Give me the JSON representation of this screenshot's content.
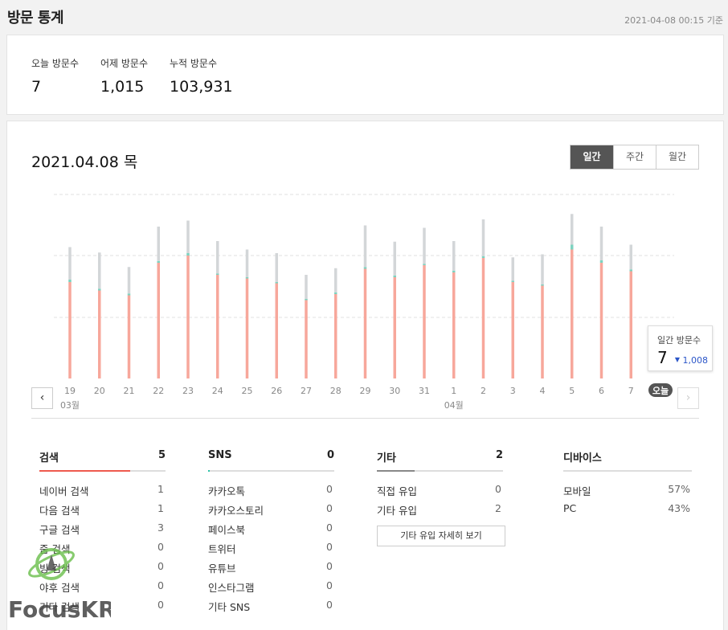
{
  "header": {
    "title": "방문 통계",
    "timestamp": "2021-04-08 00:15 기준"
  },
  "summary": [
    {
      "label": "오늘 방문수",
      "value": "7"
    },
    {
      "label": "어제 방문수",
      "value": "1,015"
    },
    {
      "label": "누적 방문수",
      "value": "103,931"
    }
  ],
  "main": {
    "date": "2021.04.08 목",
    "tabs": [
      "일간",
      "주간",
      "월간"
    ],
    "active_tab": "일간"
  },
  "chart_data": {
    "type": "bar",
    "categories": [
      "19",
      "20",
      "21",
      "22",
      "23",
      "24",
      "25",
      "26",
      "27",
      "28",
      "29",
      "30",
      "31",
      "1",
      "2",
      "3",
      "4",
      "5",
      "6",
      "7",
      "오늘"
    ],
    "month_labels": [
      {
        "label": "03월",
        "at": "19"
      },
      {
        "label": "04월",
        "at": "1"
      }
    ],
    "series": [
      {
        "values": [
          800,
          730,
          690,
          960,
          1020,
          860,
          830,
          790,
          650,
          700,
          910,
          840,
          940,
          880,
          1000,
          800,
          770,
          1070,
          960,
          890,
          7
        ]
      },
      {
        "values": [
          20,
          15,
          15,
          15,
          20,
          10,
          10,
          10,
          10,
          15,
          15,
          15,
          10,
          15,
          15,
          10,
          10,
          40,
          20,
          15,
          0
        ]
      },
      {
        "values": [
          270,
          300,
          220,
          285,
          270,
          270,
          230,
          240,
          200,
          200,
          345,
          280,
          300,
          245,
          305,
          195,
          250,
          255,
          280,
          205,
          0
        ]
      }
    ],
    "colors": [
      "#f7a79b",
      "#7dd3c0",
      "#d3d6d8"
    ],
    "grid": true,
    "highlight": "오늘"
  },
  "tooltip": {
    "label": "일간 방문수",
    "value": "7",
    "change": "1,008",
    "change_arrow": "▼"
  },
  "categories": [
    {
      "name": "검색",
      "total": "5",
      "color": "#ee5a4e",
      "fill": 0.72,
      "items": [
        {
          "name": "네이버 검색",
          "value": "1"
        },
        {
          "name": "다음 검색",
          "value": "1"
        },
        {
          "name": "구글 검색",
          "value": "3"
        },
        {
          "name": "줌 검색",
          "value": "0"
        },
        {
          "name": "빙 검색",
          "value": "0"
        },
        {
          "name": "야후 검색",
          "value": "0"
        },
        {
          "name": "기타 검색",
          "value": "0"
        }
      ]
    },
    {
      "name": "SNS",
      "total": "0",
      "color": "#2bc3a8",
      "fill": 0.01,
      "items": [
        {
          "name": "카카오톡",
          "value": "0"
        },
        {
          "name": "카카오스토리",
          "value": "0"
        },
        {
          "name": "페이스북",
          "value": "0"
        },
        {
          "name": "트위터",
          "value": "0"
        },
        {
          "name": "유튜브",
          "value": "0"
        },
        {
          "name": "인스타그램",
          "value": "0"
        },
        {
          "name": "기타 SNS",
          "value": "0"
        }
      ]
    },
    {
      "name": "기타",
      "total": "2",
      "color": "#888888",
      "fill": 0.3,
      "items": [
        {
          "name": "직접 유입",
          "value": "0"
        },
        {
          "name": "기타 유입",
          "value": "2"
        }
      ],
      "button": "기타 유입 자세히 보기"
    },
    {
      "name": "디바이스",
      "total": "",
      "color": "#dddddd",
      "fill": 0,
      "items": [
        {
          "name": "모바일",
          "value": "57%"
        },
        {
          "name": "PC",
          "value": "43%"
        }
      ]
    }
  ],
  "watermark": {
    "text": "FocusKR",
    "icon": "rocket-planet-icon"
  }
}
